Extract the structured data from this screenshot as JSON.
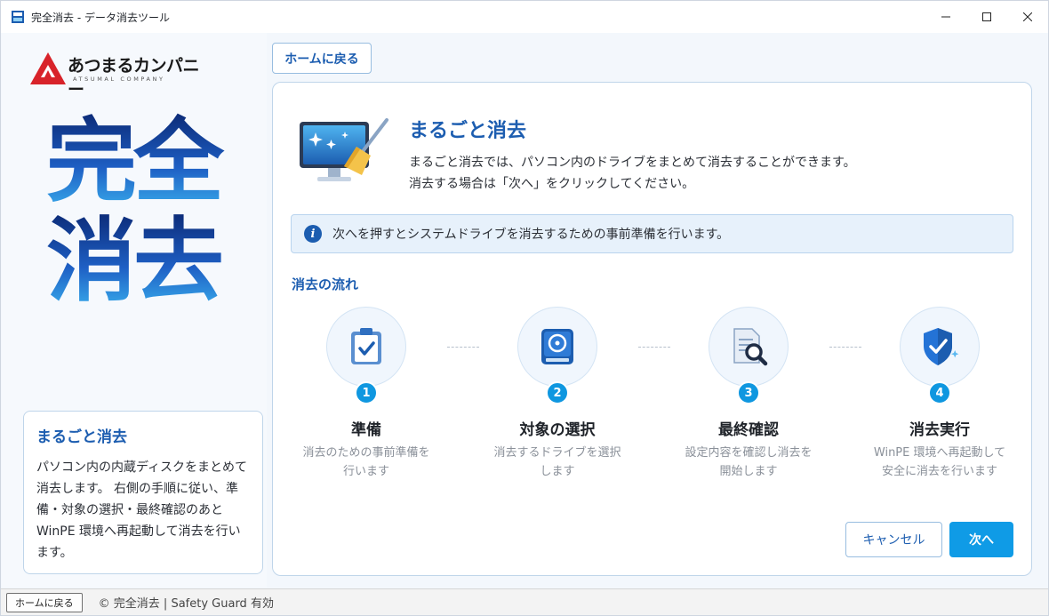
{
  "window": {
    "title": "完全消去 - データ消去ツール",
    "controls": [
      "minimize-icon",
      "maximize-icon",
      "close-icon"
    ]
  },
  "sidebar": {
    "logo_name": "あつまるカンパニー",
    "logo_sub": "ATSUMAL COMPANY",
    "big_title_line1": "完全",
    "big_title_line2": "消去",
    "card_title": "まるごと消去",
    "card_body": "パソコン内の内蔵ディスクをまとめて消去します。 右側の手順に従い、準備・対象の選択・最終確認のあと WinPE 環境へ再起動して消去を行います。"
  },
  "top_nav": {
    "home_label": "ホームに戻る"
  },
  "main": {
    "title": "まるごと消去",
    "desc_line1": "まるごと消去では、パソコン内のドライブをまとめて消去することができます。",
    "desc_line2": "消去する場合は「次へ」をクリックしてください。",
    "info_text": "次へを押すとシステムドライブを消去するための事前準備を行います。",
    "flow_title": "消去の流れ",
    "steps": [
      {
        "num": "1",
        "label": "準備",
        "desc_line1": "消去のための事前準備を",
        "desc_line2": "行います",
        "icon": "clipboard-check-icon"
      },
      {
        "num": "2",
        "label": "対象の選択",
        "desc_line1": "消去するドライブを選択",
        "desc_line2": "します",
        "icon": "hard-drive-icon"
      },
      {
        "num": "3",
        "label": "最終確認",
        "desc_line1": "設定内容を確認し消去を",
        "desc_line2": "開始します",
        "icon": "document-search-icon"
      },
      {
        "num": "4",
        "label": "消去実行",
        "desc_line1": "WinPE 環境へ再起動して",
        "desc_line2": "安全に消去を行います",
        "icon": "shield-check-icon"
      }
    ],
    "cancel_label": "キャンセル",
    "next_label": "次へ"
  },
  "statusbar": {
    "home_label": "ホームに戻る",
    "status_text": "© 完全消去 | Safety Guard 有効"
  },
  "colors": {
    "accent": "#1c5db0",
    "primary_button": "#0f9be6",
    "step_badge": "#0f97e0",
    "info_bg": "#e7f1fb"
  }
}
